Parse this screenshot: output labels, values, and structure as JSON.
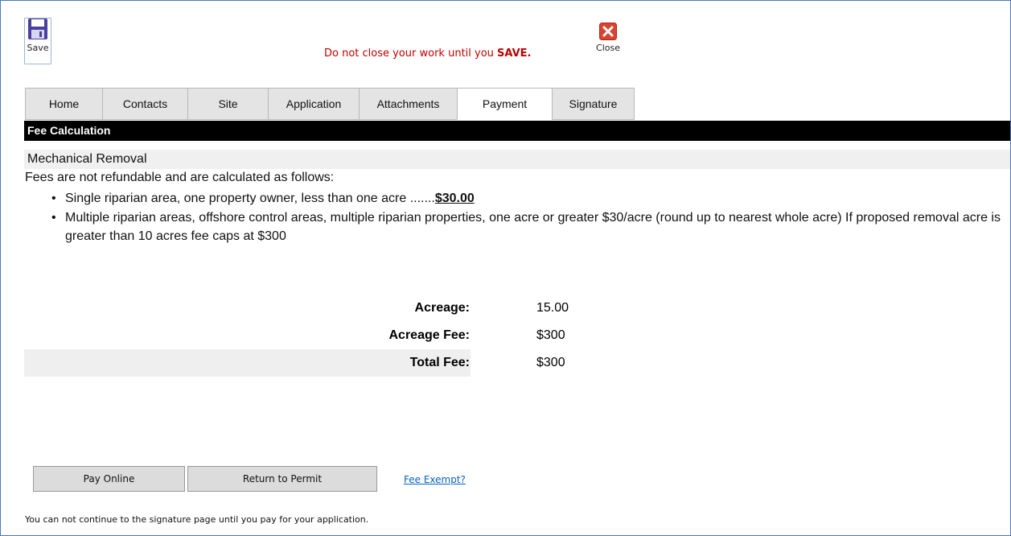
{
  "toolbar": {
    "save_label": "Save",
    "warning_prefix": "Do not close your work until you ",
    "warning_emphasis": "SAVE.",
    "close_label": "Close",
    "colors": {
      "warning": "#c00000",
      "save_icon": "#4b3fa0",
      "close_icon": "#d9432f"
    }
  },
  "tabs": [
    {
      "label": "Home",
      "active": false
    },
    {
      "label": "Contacts",
      "active": false
    },
    {
      "label": "Site",
      "active": false
    },
    {
      "label": "Application",
      "active": false
    },
    {
      "label": "Attachments",
      "active": false
    },
    {
      "label": "Payment",
      "active": true
    },
    {
      "label": "Signature",
      "active": false
    }
  ],
  "section": {
    "title": "Fee Calculation",
    "subtitle": "Mechanical Removal",
    "intro": "Fees are not refundable and are calculated as follows:",
    "fee_items": [
      {
        "text": "Single riparian area, one property owner, less than one acre  .......",
        "amount": "$30.00"
      },
      {
        "text": "Multiple riparian areas, offshore control areas, multiple riparian properties, one acre or greater $30/acre (round up to nearest whole acre)   If proposed removal acre is greater than 10 acres fee caps at $300",
        "amount": ""
      }
    ]
  },
  "calculation": {
    "acreage_label": "Acreage:",
    "acreage_value": "15.00",
    "acreage_fee_label": "Acreage Fee:",
    "acreage_fee_value": "$300",
    "total_fee_label": "Total Fee:",
    "total_fee_value": "$300"
  },
  "actions": {
    "pay_online": "Pay Online",
    "return_to_permit": "Return to Permit",
    "fee_exempt": "Fee Exempt?"
  },
  "footer_note": "You can not continue to the signature page until you pay for your application."
}
